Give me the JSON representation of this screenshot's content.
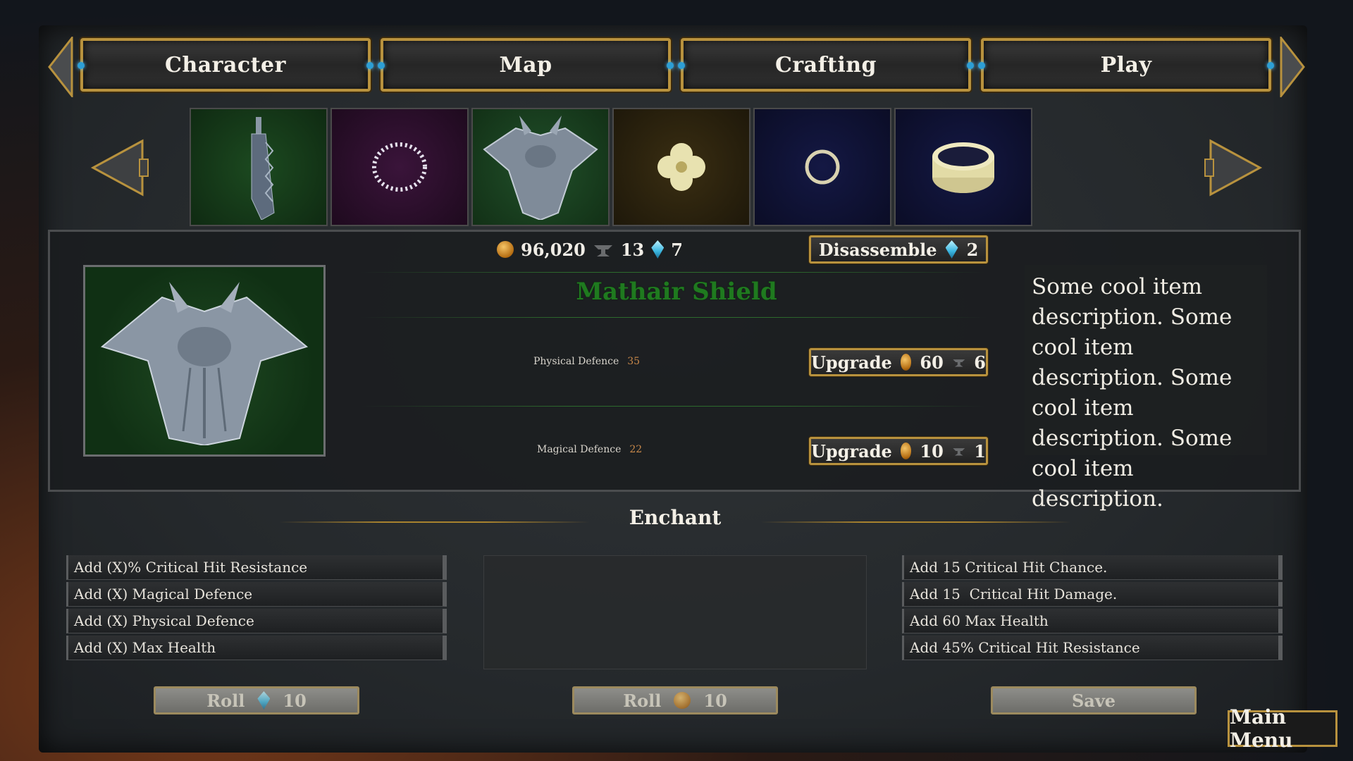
{
  "nav": {
    "tabs": [
      {
        "label": "Character"
      },
      {
        "label": "Map"
      },
      {
        "label": "Crafting"
      },
      {
        "label": "Play"
      }
    ]
  },
  "inventory": {
    "slots": [
      {
        "icon": "sword-icon",
        "bg": "#143418"
      },
      {
        "icon": "pearl-necklace-icon",
        "bg": "#2a0f2a"
      },
      {
        "icon": "dragon-shield-icon",
        "bg": "#163a18"
      },
      {
        "icon": "clover-charm-icon",
        "bg": "#2c2410"
      },
      {
        "icon": "ring-icon",
        "bg": "#0e1030"
      },
      {
        "icon": "bracelet-icon",
        "bg": "#0e1030"
      }
    ]
  },
  "currency": {
    "gold": "96,020",
    "ore": "13",
    "gems": "7"
  },
  "item": {
    "name": "Mathair Shield",
    "description": "Some cool item description. Some cool item description. Some cool item description. Some cool item description.",
    "disassemble": {
      "label": "Disassemble",
      "gems": "2"
    },
    "stats": [
      {
        "label": "Physical Defence",
        "value": "35",
        "upgrade_label": "Upgrade",
        "gold": "60",
        "ore": "6"
      },
      {
        "label": "Magical Defence",
        "value": "22",
        "upgrade_label": "Upgrade",
        "gold": "10",
        "ore": "1"
      }
    ]
  },
  "enchant": {
    "title": "Enchant",
    "options_left": [
      "Add (X)% Critical Hit Resistance",
      "Add (X) Magical Defence",
      "Add (X) Physical Defence",
      "Add (X) Max Health"
    ],
    "options_right": [
      "Add 15 Critical Hit Chance.",
      "Add 15  Critical Hit Damage.",
      "Add 60 Max Health",
      "Add 45% Critical Hit Resistance"
    ],
    "roll_gem": {
      "label": "Roll",
      "cost": "10"
    },
    "roll_gold": {
      "label": "Roll",
      "cost": "10"
    },
    "save": {
      "label": "Save"
    }
  },
  "main_menu": {
    "label": "Main Menu"
  }
}
